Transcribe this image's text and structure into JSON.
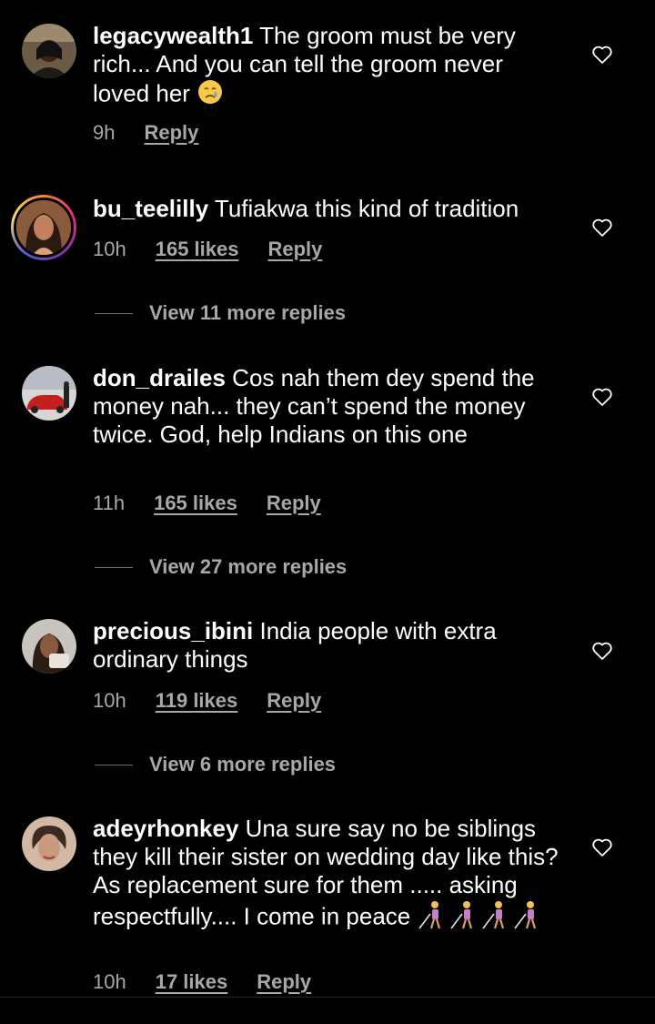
{
  "comments": [
    {
      "username": "legacywealth1",
      "text": "The groom must be very rich... And you can tell the groom never loved her",
      "emoji": "crying-face",
      "time": "9h",
      "likes": "",
      "reply": "Reply"
    },
    {
      "username": "bu_teelilly",
      "text": "Tufiakwa this kind of tradition",
      "time": "10h",
      "likes": "165 likes",
      "reply": "Reply",
      "view_more": "View 11 more replies"
    },
    {
      "username": "don_drailes",
      "text": "Cos nah them dey spend the money nah... they can’t spend the money twice. God, help Indians on this one",
      "time": "11h",
      "likes": "165 likes",
      "reply": "Reply",
      "view_more": "View 27 more replies"
    },
    {
      "username": "precious_ibini",
      "text": "India people with extra ordinary things",
      "time": "10h",
      "likes": "119 likes",
      "reply": "Reply",
      "view_more": "View 6 more replies"
    },
    {
      "username": "adeyrhonkey",
      "text": "Una sure say no be siblings they kill their sister on wedding day like this? As replacement sure for them ..... asking respectfully.... I come in peace",
      "emoji": "woman-with-white-cane x4",
      "time": "10h",
      "likes": "17 likes",
      "reply": "Reply"
    }
  ],
  "icons": {
    "like": "heart-outline-icon",
    "avatar": "user-avatar"
  },
  "colors": {
    "background": "#000000",
    "text": "#ffffff",
    "muted": "#a8a8a8",
    "story_ring_start": "#f58529",
    "story_ring_end": "#8134af"
  }
}
